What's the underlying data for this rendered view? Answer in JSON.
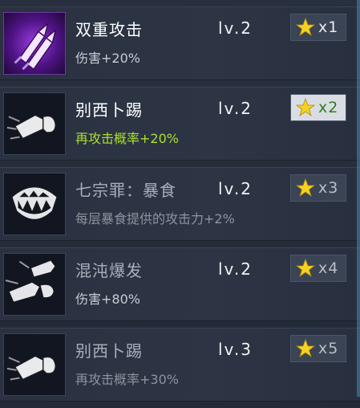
{
  "skills": [
    {
      "name": "双重攻击",
      "level": "lv.2",
      "desc": "伤害+20%",
      "count": "x1",
      "icon": "rocket-missile-icon",
      "style": "active"
    },
    {
      "name": "别西卜踢",
      "level": "lv.2",
      "desc": "再攻击概率+20%",
      "count": "x2",
      "icon": "kick-boot-icon",
      "style": "highlight"
    },
    {
      "name": "七宗罪：暴食",
      "level": "lv.2",
      "desc": "每层暴食提供的攻击力+2%",
      "count": "x3",
      "icon": "fanged-mouth-icon",
      "style": "dim"
    },
    {
      "name": "混沌爆发",
      "level": "lv.2",
      "desc": "伤害+80%",
      "count": "x4",
      "icon": "chaos-burst-fist-icon",
      "style": "dim"
    },
    {
      "name": "别西卜踢",
      "level": "lv.3",
      "desc": "再攻击概率+30%",
      "count": "x5",
      "icon": "kick-boot-icon",
      "style": "normal"
    }
  ],
  "colors": {
    "star": "#f5d21f",
    "green": "#a8e12b",
    "purple": "#9a3de0"
  }
}
